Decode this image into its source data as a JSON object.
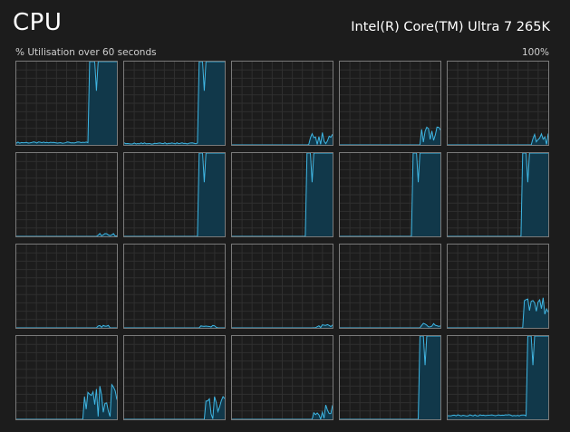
{
  "header": {
    "title": "CPU",
    "cpu_model": "Intel(R) Core(TM) Ultra 7 265K",
    "subtitle": "% Utilisation over 60 seconds",
    "max_label": "100%"
  },
  "colors": {
    "background": "#1c1c1c",
    "border": "#7a7a7a",
    "gridline": "#2f2f2f",
    "line": "#3fb6e3",
    "fill": "#11384a"
  },
  "chart_data": {
    "type": "area",
    "ylim": [
      0,
      100
    ],
    "x_window_seconds": 60,
    "series": [
      {
        "values": [
          2,
          2,
          2,
          2,
          2,
          2,
          3,
          2,
          2,
          2,
          2,
          2,
          2,
          2,
          2,
          2,
          2,
          2,
          3,
          2,
          2,
          2,
          2,
          2,
          2,
          2,
          2,
          2,
          2,
          2,
          2,
          2,
          2,
          2,
          2,
          2,
          2,
          2,
          2,
          3,
          100,
          100,
          100,
          100,
          100,
          100,
          70,
          100,
          100,
          100,
          100,
          100,
          100,
          100,
          100,
          100,
          100,
          100,
          100,
          100
        ]
      },
      {
        "values": [
          0,
          0,
          0,
          0,
          0,
          0,
          0,
          0,
          0,
          0,
          0,
          0,
          0,
          0,
          0,
          0,
          0,
          0,
          0,
          0,
          0,
          0,
          0,
          2,
          0,
          0,
          0,
          0,
          0,
          0,
          0,
          0,
          0,
          0,
          0,
          0,
          0,
          0,
          0,
          0,
          0,
          0,
          100,
          100,
          100,
          100,
          60,
          100,
          100,
          100,
          100,
          100,
          100,
          100,
          100,
          100,
          100,
          100,
          100,
          100
        ]
      },
      {
        "values": [
          0,
          0,
          0,
          0,
          0,
          0,
          0,
          0,
          0,
          0,
          0,
          0,
          0,
          0,
          0,
          0,
          0,
          0,
          0,
          0,
          0,
          0,
          0,
          0,
          0,
          0,
          0,
          0,
          0,
          0,
          0,
          0,
          0,
          0,
          0,
          0,
          0,
          0,
          0,
          0,
          0,
          0,
          0,
          0,
          0,
          1,
          2,
          3,
          5,
          4,
          10,
          6,
          15,
          5,
          8,
          6,
          14,
          5,
          8,
          5
        ]
      },
      {
        "values": [
          0,
          0,
          0,
          0,
          0,
          0,
          0,
          0,
          0,
          0,
          0,
          0,
          0,
          0,
          0,
          0,
          0,
          0,
          0,
          0,
          0,
          0,
          0,
          0,
          0,
          0,
          0,
          0,
          0,
          0,
          0,
          0,
          0,
          0,
          0,
          0,
          0,
          0,
          0,
          0,
          0,
          0,
          0,
          0,
          0,
          0,
          0,
          0,
          0,
          1,
          2,
          3,
          4,
          6,
          12,
          5,
          18,
          8,
          24,
          3
        ]
      },
      {
        "values": [
          0,
          0,
          0,
          0,
          0,
          0,
          0,
          0,
          0,
          0,
          0,
          0,
          0,
          0,
          0,
          0,
          0,
          0,
          0,
          0,
          0,
          0,
          0,
          0,
          0,
          0,
          0,
          0,
          0,
          0,
          0,
          0,
          0,
          0,
          0,
          0,
          0,
          0,
          0,
          0,
          0,
          0,
          0,
          0,
          0,
          0,
          0,
          0,
          0,
          0,
          1,
          2,
          3,
          5,
          10,
          3,
          14,
          6,
          9,
          8
        ]
      },
      {
        "values": [
          0,
          0,
          0,
          0,
          0,
          0,
          0,
          0,
          0,
          0,
          0,
          0,
          0,
          0,
          0,
          0,
          0,
          0,
          0,
          0,
          0,
          0,
          0,
          0,
          0,
          0,
          0,
          0,
          0,
          0,
          0,
          0,
          0,
          0,
          0,
          0,
          0,
          0,
          0,
          0,
          0,
          0,
          0,
          0,
          0,
          0,
          0,
          0,
          0,
          0,
          0,
          0,
          0,
          0,
          0,
          0,
          0,
          0,
          0,
          0
        ]
      },
      {
        "values": [
          0,
          0,
          0,
          0,
          0,
          0,
          0,
          0,
          0,
          0,
          0,
          0,
          0,
          0,
          0,
          0,
          0,
          0,
          0,
          0,
          0,
          0,
          0,
          0,
          0,
          0,
          0,
          0,
          0,
          0,
          0,
          0,
          0,
          0,
          0,
          0,
          0,
          0,
          0,
          0,
          0,
          0,
          0,
          0,
          0,
          0,
          0,
          0,
          0,
          0,
          0,
          0,
          0,
          0,
          0,
          0,
          0,
          0,
          0,
          0
        ]
      },
      {
        "values": [
          0,
          0,
          0,
          0,
          0,
          0,
          0,
          0,
          0,
          0,
          0,
          0,
          0,
          0,
          0,
          0,
          0,
          0,
          0,
          0,
          0,
          0,
          0,
          0,
          0,
          0,
          0,
          0,
          0,
          0,
          0,
          0,
          0,
          0,
          0,
          0,
          0,
          0,
          0,
          0,
          0,
          0,
          0,
          0,
          0,
          0,
          0,
          0,
          0,
          0,
          0,
          0,
          0,
          0,
          0,
          0,
          0,
          0,
          0,
          0
        ]
      },
      {
        "values": [
          0,
          0,
          0,
          0,
          0,
          0,
          0,
          0,
          0,
          0,
          0,
          0,
          0,
          0,
          0,
          0,
          0,
          0,
          0,
          0,
          0,
          0,
          0,
          0,
          0,
          0,
          0,
          0,
          0,
          0,
          0,
          0,
          0,
          0,
          0,
          0,
          0,
          0,
          0,
          0,
          0,
          0,
          0,
          0,
          0,
          0,
          0,
          0,
          0,
          0,
          0,
          0,
          0,
          0,
          0,
          0,
          0,
          0,
          0,
          0
        ]
      },
      {
        "values": [
          0,
          0,
          0,
          0,
          0,
          0,
          0,
          0,
          0,
          0,
          0,
          0,
          0,
          0,
          0,
          0,
          0,
          0,
          0,
          0,
          0,
          0,
          0,
          0,
          0,
          0,
          0,
          0,
          0,
          0,
          0,
          0,
          0,
          0,
          0,
          0,
          0,
          0,
          0,
          0,
          0,
          0,
          0,
          0,
          0,
          0,
          0,
          0,
          0,
          0,
          0,
          0,
          0,
          0,
          0,
          0,
          0,
          0,
          0,
          0
        ]
      },
      {
        "values": [
          0,
          0,
          0,
          0,
          0,
          0,
          0,
          0,
          0,
          0,
          0,
          0,
          0,
          0,
          0,
          0,
          0,
          0,
          0,
          0,
          0,
          0,
          0,
          0,
          0,
          0,
          0,
          0,
          0,
          0,
          0,
          0,
          0,
          0,
          0,
          0,
          0,
          0,
          0,
          0,
          0,
          0,
          0,
          0,
          0,
          0,
          0,
          0,
          0,
          0,
          0,
          0,
          0,
          0,
          0,
          0,
          0,
          0,
          0,
          0
        ]
      },
      {
        "values": [
          0,
          0,
          0,
          0,
          0,
          0,
          0,
          0,
          0,
          0,
          0,
          0,
          0,
          0,
          0,
          0,
          0,
          0,
          0,
          0,
          0,
          0,
          0,
          0,
          0,
          0,
          0,
          0,
          0,
          0,
          0,
          0,
          0,
          0,
          0,
          0,
          0,
          0,
          0,
          0,
          0,
          0,
          0,
          0,
          0,
          0,
          0,
          0,
          0,
          0,
          0,
          0,
          0,
          0,
          0,
          0,
          0,
          0,
          0,
          0
        ]
      },
      {
        "values": [
          0,
          0,
          0,
          0,
          0,
          0,
          0,
          0,
          0,
          0,
          0,
          0,
          0,
          0,
          0,
          0,
          0,
          0,
          0,
          0,
          0,
          0,
          0,
          0,
          0,
          0,
          0,
          0,
          0,
          0,
          0,
          0,
          0,
          0,
          0,
          0,
          0,
          0,
          0,
          0,
          0,
          0,
          0,
          0,
          0,
          0,
          0,
          0,
          0,
          0,
          0,
          0,
          0,
          0,
          0,
          0,
          0,
          0,
          0,
          0
        ]
      },
      {
        "values": [
          0,
          0,
          0,
          0,
          0,
          0,
          0,
          0,
          0,
          0,
          0,
          0,
          0,
          0,
          0,
          0,
          0,
          0,
          0,
          0,
          0,
          0,
          0,
          0,
          0,
          0,
          0,
          0,
          0,
          0,
          0,
          0,
          0,
          0,
          0,
          0,
          0,
          0,
          0,
          0,
          0,
          0,
          0,
          0,
          0,
          0,
          0,
          0,
          0,
          0,
          0,
          0,
          0,
          0,
          0,
          0,
          0,
          0,
          0,
          0
        ]
      },
      {
        "values": [
          0,
          0,
          0,
          0,
          0,
          0,
          0,
          0,
          0,
          0,
          0,
          0,
          0,
          0,
          0,
          0,
          0,
          0,
          0,
          0,
          0,
          0,
          0,
          0,
          0,
          0,
          0,
          0,
          0,
          0,
          0,
          0,
          0,
          0,
          0,
          0,
          0,
          0,
          0,
          0,
          0,
          0,
          0,
          0,
          0,
          0,
          0,
          0,
          0,
          0,
          0,
          0,
          0,
          0,
          0,
          0,
          0,
          0,
          0,
          0
        ]
      },
      {
        "values": [
          0,
          0,
          0,
          0,
          0,
          0,
          0,
          0,
          0,
          0,
          0,
          0,
          0,
          0,
          0,
          0,
          0,
          0,
          0,
          0,
          0,
          0,
          0,
          0,
          0,
          0,
          0,
          0,
          0,
          0,
          0,
          0,
          0,
          0,
          0,
          0,
          0,
          0,
          0,
          0,
          0,
          0,
          0,
          0,
          0,
          0,
          0,
          0,
          0,
          0,
          0,
          0,
          0,
          0,
          0,
          0,
          0,
          0,
          0,
          0
        ]
      },
      {
        "values": [
          0,
          0,
          0,
          0,
          0,
          0,
          0,
          0,
          0,
          0,
          0,
          0,
          0,
          0,
          0,
          0,
          0,
          0,
          0,
          0,
          0,
          0,
          0,
          0,
          0,
          0,
          0,
          0,
          0,
          0,
          0,
          0,
          0,
          0,
          0,
          0,
          0,
          0,
          0,
          0,
          0,
          0,
          0,
          0,
          0,
          0,
          0,
          0,
          0,
          0,
          0,
          0,
          0,
          0,
          0,
          0,
          0,
          0,
          0,
          0
        ]
      },
      {
        "values": [
          0,
          0,
          0,
          0,
          0,
          0,
          0,
          0,
          0,
          0,
          0,
          0,
          0,
          0,
          0,
          0,
          0,
          0,
          0,
          0,
          0,
          0,
          0,
          0,
          0,
          0,
          0,
          0,
          0,
          0,
          0,
          0,
          0,
          0,
          0,
          0,
          0,
          0,
          0,
          0,
          0,
          0,
          0,
          0,
          0,
          0,
          0,
          0,
          0,
          0,
          0,
          0,
          0,
          0,
          0,
          0,
          0,
          0,
          0,
          0
        ]
      },
      {
        "values": [
          0,
          0,
          0,
          0,
          0,
          0,
          0,
          0,
          0,
          0,
          0,
          0,
          0,
          0,
          0,
          0,
          0,
          0,
          0,
          0,
          0,
          0,
          0,
          0,
          0,
          0,
          0,
          0,
          0,
          0,
          0,
          0,
          0,
          0,
          0,
          0,
          0,
          0,
          0,
          0,
          0,
          0,
          0,
          0,
          0,
          0,
          0,
          0,
          0,
          0,
          0,
          0,
          0,
          0,
          0,
          0,
          0,
          0,
          0,
          0
        ]
      },
      {
        "values": [
          0,
          0,
          0,
          0,
          0,
          0,
          0,
          0,
          0,
          0,
          0,
          0,
          0,
          0,
          0,
          0,
          0,
          0,
          0,
          0,
          0,
          0,
          0,
          0,
          0,
          0,
          0,
          0,
          0,
          0,
          0,
          0,
          0,
          0,
          0,
          0,
          0,
          0,
          0,
          0,
          0,
          0,
          0,
          0,
          0,
          0,
          0,
          0,
          0,
          0,
          0,
          0,
          0,
          0,
          0,
          0,
          0,
          0,
          0,
          0
        ]
      }
    ]
  }
}
